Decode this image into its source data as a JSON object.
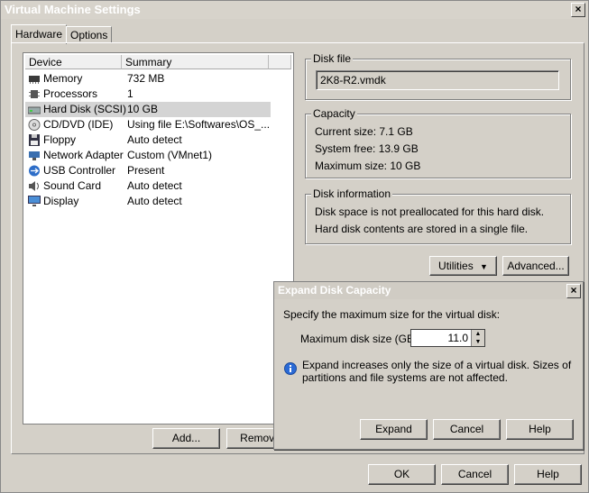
{
  "window": {
    "title": "Virtual Machine Settings",
    "close_label": "×"
  },
  "tabs": [
    {
      "label": "Hardware"
    },
    {
      "label": "Options"
    }
  ],
  "device_list": {
    "columns": {
      "device": "Device",
      "summary": "Summary"
    },
    "rows": [
      {
        "device": "Memory",
        "summary": "732 MB",
        "icon": "memory-icon"
      },
      {
        "device": "Processors",
        "summary": "1",
        "icon": "processor-icon"
      },
      {
        "device": "Hard Disk (SCSI)",
        "summary": "10 GB",
        "icon": "hard-disk-icon"
      },
      {
        "device": "CD/DVD (IDE)",
        "summary": "Using file E:\\Softwares\\OS_...",
        "icon": "cd-dvd-icon"
      },
      {
        "device": "Floppy",
        "summary": "Auto detect",
        "icon": "floppy-icon"
      },
      {
        "device": "Network Adapter",
        "summary": "Custom (VMnet1)",
        "icon": "network-adapter-icon"
      },
      {
        "device": "USB Controller",
        "summary": "Present",
        "icon": "usb-icon"
      },
      {
        "device": "Sound Card",
        "summary": "Auto detect",
        "icon": "sound-card-icon"
      },
      {
        "device": "Display",
        "summary": "Auto detect",
        "icon": "display-icon"
      }
    ]
  },
  "disk_file": {
    "legend": "Disk file",
    "value": "2K8-R2.vmdk"
  },
  "capacity": {
    "legend": "Capacity",
    "current": "Current size:  7.1 GB",
    "free": "System free:  13.9 GB",
    "max": "Maximum size:  10 GB"
  },
  "disk_info": {
    "legend": "Disk information",
    "line1": "Disk space is not preallocated for this hard disk.",
    "line2": "Hard disk contents are stored in a single file."
  },
  "buttons": {
    "utilities": "Utilities",
    "advanced": "Advanced...",
    "add": "Add...",
    "remove": "Remove",
    "ok": "OK",
    "cancel": "Cancel",
    "help": "Help"
  },
  "expand_dialog": {
    "title": "Expand Disk Capacity",
    "close_label": "×",
    "prompt": "Specify the maximum size for the virtual disk:",
    "field_label": "Maximum disk size (GB):",
    "field_value": "11.0",
    "info_line1": "Expand increases only the size of a virtual disk. Sizes of",
    "info_line2": "partitions and file systems are not affected.",
    "expand": "Expand",
    "cancel": "Cancel",
    "help": "Help"
  },
  "colors": {
    "accent": "#000080",
    "selection": "#d4d4d4",
    "face": "#d4d0c8"
  }
}
